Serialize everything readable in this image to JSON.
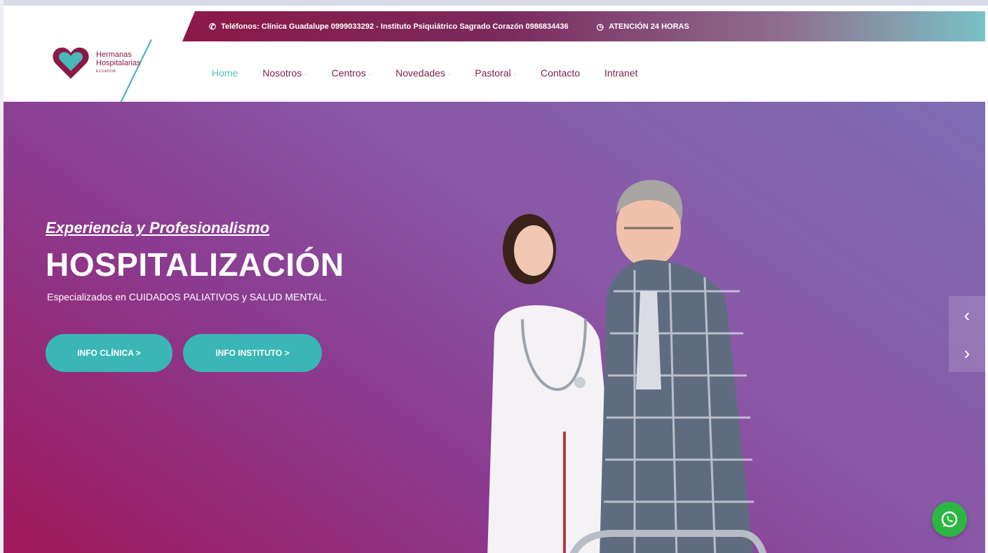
{
  "topbar": {
    "phone_icon": "phone-icon",
    "phones_text": "Teléfonos: Clínica Guadalupe 0999033292 - Instituto Psiquiátrico Sagrado Corazón 0986834436",
    "clock_icon": "clock-icon",
    "attention_text": "ATENCIÓN 24 HORAS"
  },
  "logo": {
    "line1": "Hermanas",
    "line2": "Hospitalarias",
    "line3": "ECUADOR"
  },
  "nav": {
    "items": [
      {
        "label": "Home",
        "active": true,
        "dropdown": false
      },
      {
        "label": "Nosotros",
        "dropdown": true
      },
      {
        "label": "Centros",
        "dropdown": true
      },
      {
        "label": "Novedades",
        "dropdown": true
      },
      {
        "label": "Pastoral",
        "dropdown": true
      },
      {
        "label": "Contacto",
        "dropdown": false
      },
      {
        "label": "Intranet",
        "dropdown": false
      }
    ],
    "caret": "-"
  },
  "hero": {
    "kicker": "Experiencia y Profesionalismo",
    "title": "HOSPITALIZACIÓN",
    "subtitle": "Especializados en CUIDADOS PALIATIVOS y SALUD MENTAL.",
    "btn_clinica": "INFO CLÍNICA  >",
    "btn_instituto": "INFO INSTITUTO  >",
    "prev_arrow": "‹",
    "next_arrow": "›"
  },
  "colors": {
    "brand": "#8c1848",
    "accent": "#3bb6b6",
    "whatsapp": "#2cb742"
  }
}
